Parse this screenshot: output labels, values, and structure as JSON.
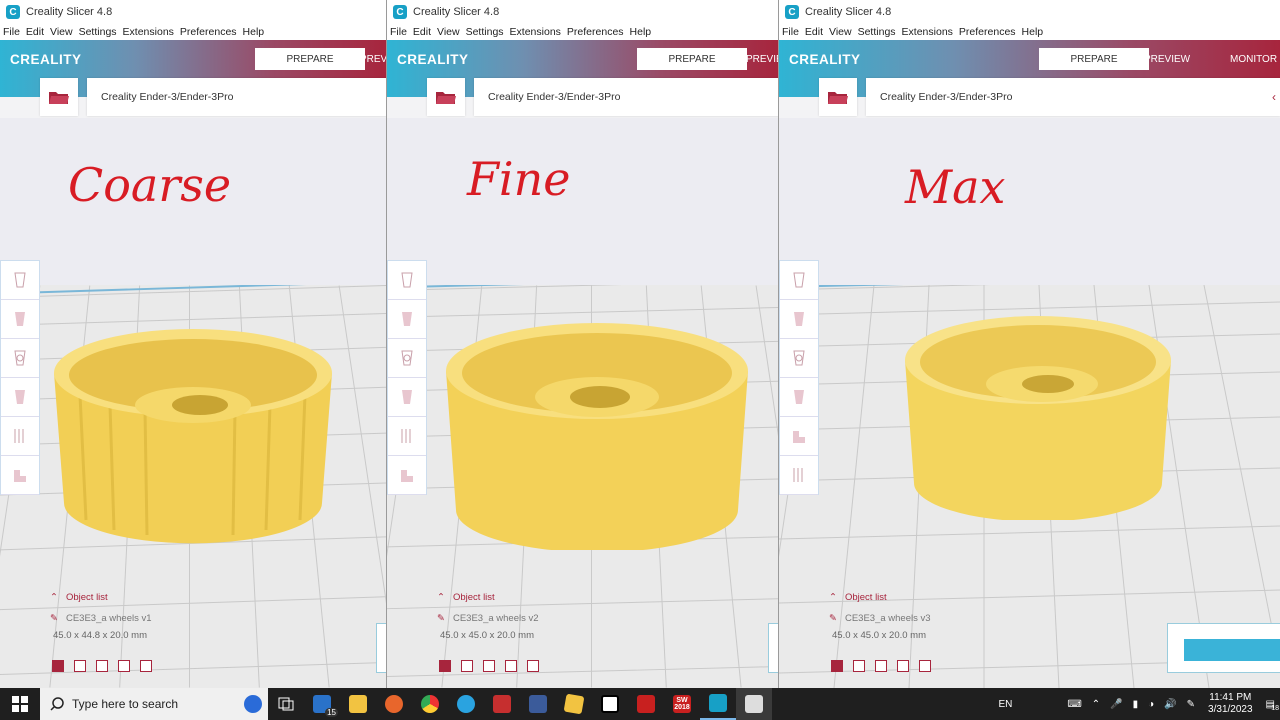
{
  "app": {
    "title": "Creality Slicer 4.8",
    "logo": "CREALITY"
  },
  "menu": [
    "File",
    "Edit",
    "View",
    "Settings",
    "Extensions",
    "Preferences",
    "Help"
  ],
  "stages": {
    "prepare": "PREPARE",
    "preview_truncated": "PREVIE",
    "preview": "PREVIEW",
    "monitor": "MONITOR"
  },
  "printer": "Creality Ender-3/Ender-3Pro",
  "panes": [
    {
      "label": "Coarse",
      "object_list": "Object list",
      "object_name": "CE3E3_a wheels v1",
      "dims": "45.0 x 44.8 x 20.0 mm"
    },
    {
      "label": "Fine",
      "object_list": "Object list",
      "object_name": "CE3E3_a wheels v2",
      "dims": "45.0 x 45.0 x 20.0 mm"
    },
    {
      "label": "Max",
      "object_list": "Object list",
      "object_name": "CE3E3_a wheels v3",
      "dims": "45.0 x 45.0 x 20.0 mm"
    }
  ],
  "taskbar": {
    "search_placeholder": "Type here to search",
    "mail_badge": "15",
    "sw_label": "SW",
    "sw_year": "2018",
    "lang": "EN",
    "time": "11:41 PM",
    "date": "3/31/2023",
    "notif_count": "18"
  },
  "colors": {
    "header_start": "#2fb4d4",
    "header_end": "#a7253d",
    "accent": "#a7253d",
    "wheel": "#f7dc6f",
    "handwriting": "#d81c24"
  }
}
